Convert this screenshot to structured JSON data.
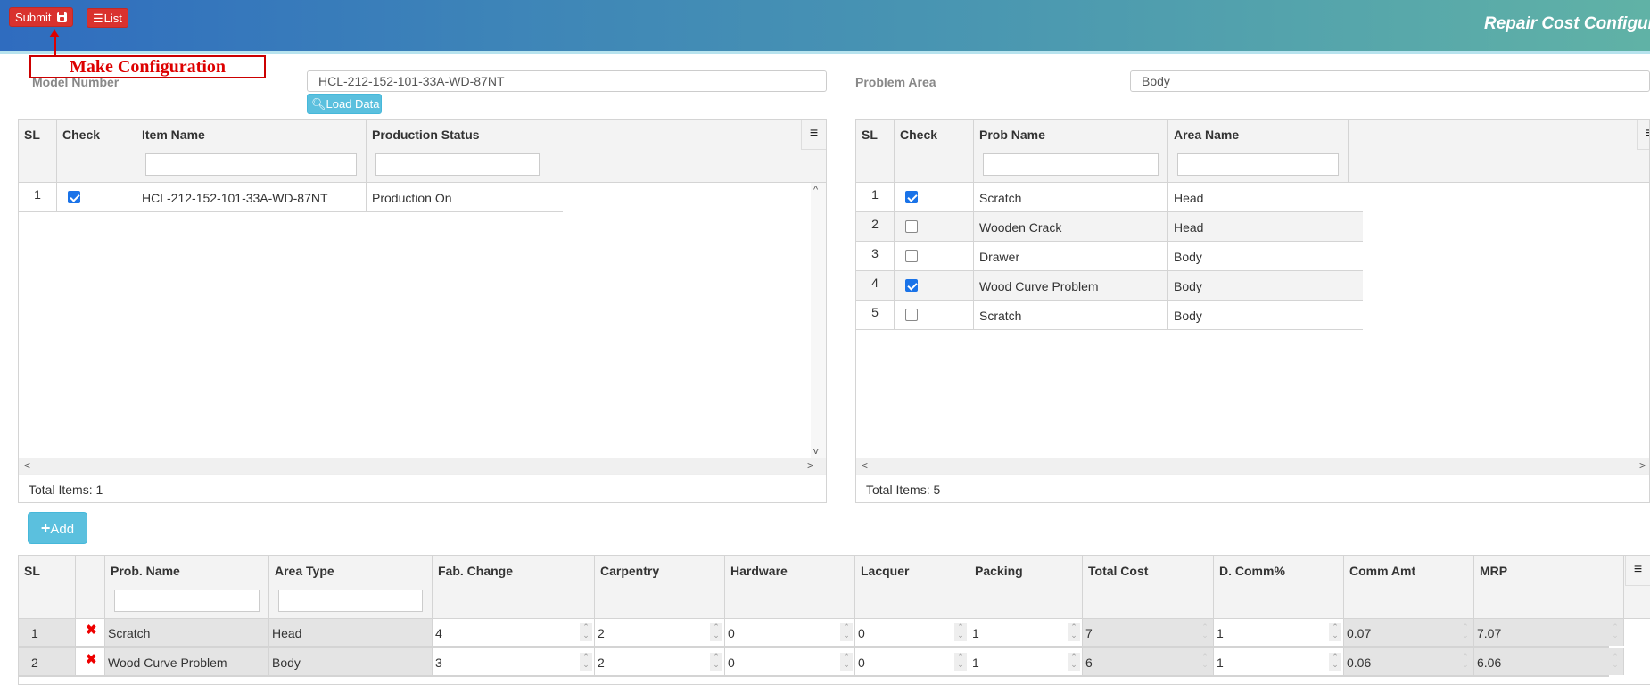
{
  "header": {
    "submit_label": "Submit",
    "list_label": "List",
    "title": "Repair Cost Configur",
    "annotation": "Make Configuration"
  },
  "form": {
    "model_number_label": "Model Number",
    "model_number_value": "HCL-212-152-101-33A-WD-87NT",
    "load_data_label": "Load Data",
    "problem_area_label": "Problem Area",
    "problem_area_value": "Body"
  },
  "items_grid": {
    "columns": [
      "SL",
      "Check",
      "Item Name",
      "Production Status"
    ],
    "rows": [
      {
        "sl": "1",
        "checked": true,
        "item_name": "HCL-212-152-101-33A-WD-87NT",
        "status": "Production On"
      }
    ],
    "footer": "Total Items: 1"
  },
  "problems_grid": {
    "columns": [
      "SL",
      "Check",
      "Prob Name",
      "Area Name"
    ],
    "rows": [
      {
        "sl": "1",
        "checked": true,
        "name": "Scratch",
        "area": "Head"
      },
      {
        "sl": "2",
        "checked": false,
        "name": "Wooden Crack",
        "area": "Head"
      },
      {
        "sl": "3",
        "checked": false,
        "name": "Drawer",
        "area": "Body"
      },
      {
        "sl": "4",
        "checked": true,
        "name": "Wood Curve Problem",
        "area": "Body"
      },
      {
        "sl": "5",
        "checked": false,
        "name": "Scratch",
        "area": "Body"
      }
    ],
    "footer": "Total Items: 5"
  },
  "add_label": "Add",
  "cost_grid": {
    "columns": [
      "SL",
      "",
      "Prob. Name",
      "Area Type",
      "Fab. Change",
      "Carpentry",
      "Hardware",
      "Lacquer",
      "Packing",
      "Total Cost",
      "D. Comm%",
      "Comm Amt",
      "MRP"
    ],
    "rows": [
      {
        "sl": "1",
        "name": "Scratch",
        "area": "Head",
        "fab": "4",
        "carpentry": "2",
        "hardware": "0",
        "lacquer": "0",
        "packing": "1",
        "total": "7",
        "dcomm": "1",
        "comm_amt": "0.07",
        "mrp": "7.07"
      },
      {
        "sl": "2",
        "name": "Wood Curve Problem",
        "area": "Body",
        "fab": "3",
        "carpentry": "2",
        "hardware": "0",
        "lacquer": "0",
        "packing": "1",
        "total": "6",
        "dcomm": "1",
        "comm_amt": "0.06",
        "mrp": "6.06"
      }
    ]
  },
  "icons": {
    "delete": "✖",
    "menu": "≡",
    "search": "🔍",
    "plus": "+",
    "list": "☰",
    "save": "floppy-disk"
  }
}
